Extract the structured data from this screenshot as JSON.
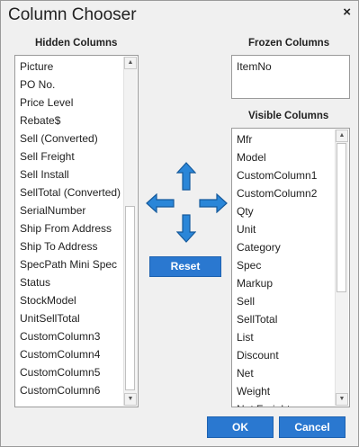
{
  "dialog": {
    "title": "Column Chooser",
    "close_glyph": "×"
  },
  "hidden_columns": {
    "label": "Hidden Columns",
    "items": [
      "Picture",
      "PO No.",
      "Price Level",
      "Rebate$",
      "Sell (Converted)",
      "Sell Freight",
      "Sell Install",
      "SellTotal (Converted)",
      "SerialNumber",
      "Ship From Address",
      "Ship To Address",
      "SpecPath Mini Spec",
      "Status",
      "StockModel",
      "UnitSellTotal",
      "CustomColumn3",
      "CustomColumn4",
      "CustomColumn5",
      "CustomColumn6"
    ]
  },
  "frozen_columns": {
    "label": "Frozen Columns",
    "items": [
      "ItemNo"
    ]
  },
  "visible_columns": {
    "label": "Visible Columns",
    "items": [
      "Mfr",
      "Model",
      "CustomColumn1",
      "CustomColumn2",
      "Qty",
      "Unit",
      "Category",
      "Spec",
      "Markup",
      "Sell",
      "SellTotal",
      "List",
      "Discount",
      "Net",
      "Weight",
      "Net Freight"
    ]
  },
  "move_arrows": {
    "up_icon": "arrow-up-icon",
    "down_icon": "arrow-down-icon",
    "left_icon": "arrow-left-icon",
    "right_icon": "arrow-right-icon"
  },
  "buttons": {
    "reset": "Reset",
    "ok": "OK",
    "cancel": "Cancel"
  },
  "colors": {
    "accent": "#2a78d0",
    "background": "#f0f0f0"
  }
}
